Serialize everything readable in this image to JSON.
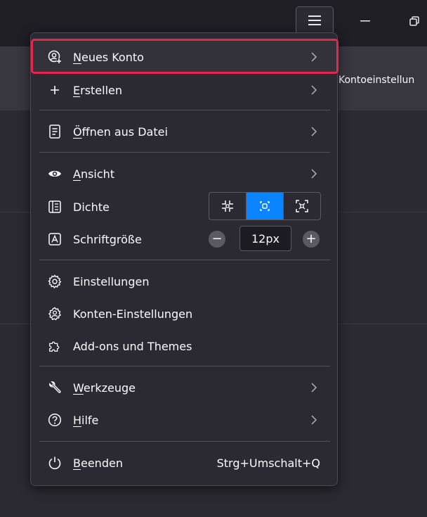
{
  "background": {
    "partial_label": "Kontoeinstellun"
  },
  "titlebar": {
    "menu_icon": "hamburger-icon",
    "minimize_icon": "minimize-icon",
    "restore_icon": "restore-icon"
  },
  "menu": {
    "items": [
      {
        "id": "neues-konto",
        "icon": "add-account-icon",
        "underline": "N",
        "rest": "eues Konto",
        "submenu": true
      },
      {
        "id": "erstellen",
        "icon": "plus-icon",
        "underline": "E",
        "rest": "rstellen",
        "submenu": true
      },
      {
        "id": "oeffnen",
        "icon": "file-icon",
        "underline": "Ö",
        "rest": "ffnen aus Datei",
        "submenu": true
      },
      {
        "id": "ansicht",
        "icon": "eye-icon",
        "underline": "A",
        "rest": "nsicht",
        "submenu": true
      },
      {
        "id": "dichte",
        "icon": "density-icon",
        "label": "Dichte"
      },
      {
        "id": "schriftgroesse",
        "icon": "font-size-icon",
        "label": "Schriftgröße"
      },
      {
        "id": "einstellungen",
        "icon": "gear-icon",
        "label": "Einstellungen"
      },
      {
        "id": "konten-einstellungen",
        "icon": "account-settings-icon",
        "label": "Konten-Einstellungen"
      },
      {
        "id": "addons",
        "icon": "puzzle-icon",
        "label": "Add-ons und Themes"
      },
      {
        "id": "werkzeuge",
        "icon": "wrench-icon",
        "underline": "W",
        "rest": "erkzeuge",
        "submenu": true
      },
      {
        "id": "hilfe",
        "icon": "help-icon",
        "underline": "H",
        "rest": "ilfe",
        "submenu": true
      },
      {
        "id": "beenden",
        "icon": "power-icon",
        "underline": "B",
        "rest": "eenden",
        "shortcut": "Strg+Umschalt+Q"
      }
    ],
    "density": {
      "options": [
        "compact",
        "normal",
        "touch"
      ],
      "selected": "normal"
    },
    "font_size": {
      "value": "12px",
      "minus": "−",
      "plus": "+"
    }
  },
  "colors": {
    "accent": "#0a84ff",
    "highlight": "#e22850",
    "menu_bg": "#2b2a33",
    "text": "#fbfbfe"
  }
}
